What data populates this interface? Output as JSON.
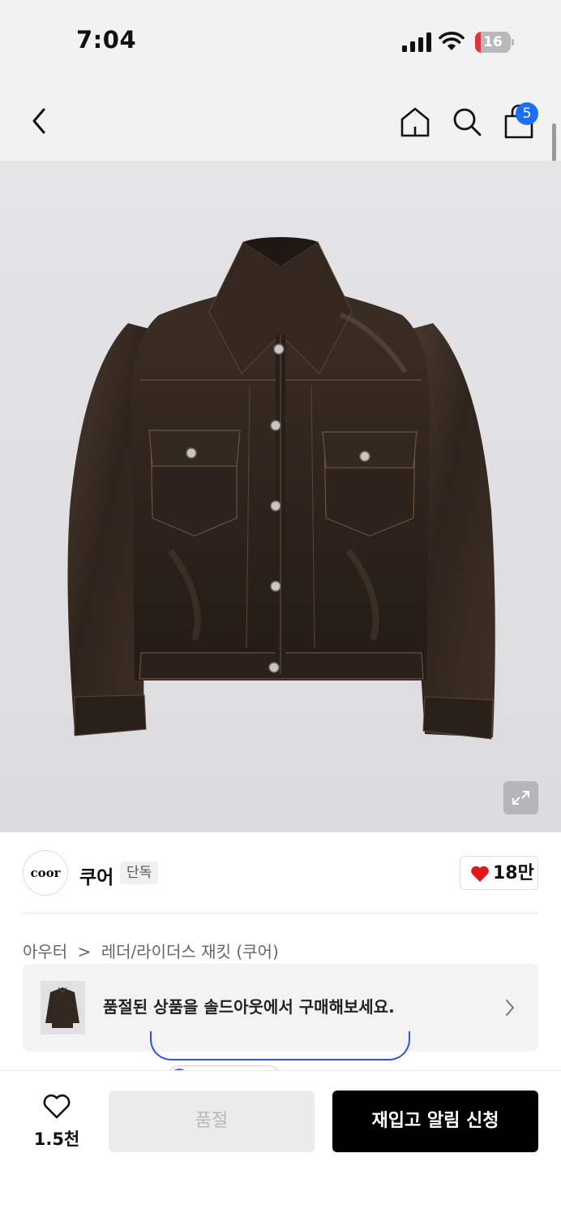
{
  "status_bar": {
    "time": "7:04",
    "battery": "16",
    "battery_level": 0.16,
    "icons": [
      "cellular-signal-icon",
      "wifi-icon",
      "battery-charging-icon"
    ]
  },
  "nav": {
    "icons": [
      "back-arrow-icon",
      "home-icon",
      "search-icon",
      "shopping-bag-icon"
    ],
    "cart_count": "5",
    "badge_color": "#1e6ef5"
  },
  "product_image": {
    "icons": [
      "expand-icon"
    ]
  },
  "brand": {
    "logo_text": "coor",
    "name": "쿠어",
    "tag": "단독",
    "likes": "18만",
    "like_color": "#e0181d"
  },
  "breadcrumb": {
    "category": "아우터",
    "separator": ">",
    "subcategory": "레더/라이더스 재킷 (쿠어)"
  },
  "soldout_banner": {
    "text": "품절된 상품을 솔드아웃에서 구매해보세요."
  },
  "bottom_bar": {
    "wish_count": "1.5천",
    "soldout_label": "품절",
    "restock_label": "재입고 알림 신청"
  }
}
